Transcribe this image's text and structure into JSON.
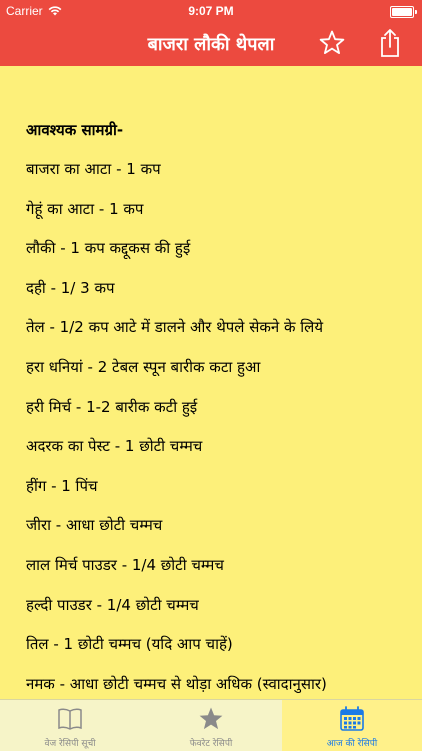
{
  "statusbar": {
    "carrier": "Carrier",
    "time": "9:07 PM"
  },
  "navbar": {
    "title": "बाजरा लौकी थेपला",
    "favorite_icon": "star-outline-icon",
    "share_icon": "share-icon"
  },
  "recipe": {
    "heading": "आवश्यक सामग्री-",
    "ingredients": [
      "बाजरा का आटा - 1 कप",
      "गेहूं का आटा - 1 कप",
      "लौकी - 1 कप कद्दूकस की हुई",
      "दही - 1/ 3 कप",
      "तेल - 1/2 कप आटे में डालने और थेपले सेकने के लिये",
      "हरा धनियां - 2 टेबल स्पून बारीक कटा हुआ",
      "हरी मिर्च - 1-2 बारीक कटी हुई",
      "अदरक का पेस्ट - 1 छोटी चम्मच",
      "हींग - 1 पिंच",
      "जीरा - आधा छोटी चम्मच",
      "लाल मिर्च पाउडर - 1/4 छोटी चम्मच",
      "हल्दी पाउडर - 1/4 छोटी चम्मच",
      "तिल - 1 छोटी चम्मच (यदि आप चाहें)",
      "नमक - आधा छोटी चम्मच से थोड़ा अधिक (स्वादानुसार)"
    ]
  },
  "tabbar": {
    "tabs": [
      {
        "label": "वेज रेसिपी सूची",
        "icon": "book-icon",
        "active": false
      },
      {
        "label": "फेवरेट रेसिपी",
        "icon": "star-icon",
        "active": false
      },
      {
        "label": "आज की रेसिपी",
        "icon": "calendar-icon",
        "active": true
      }
    ]
  },
  "colors": {
    "navbar": "#ec4a3f",
    "background": "#fdf07a",
    "tabbar": "#f6f4c8",
    "active_tab": "#1a7ae6"
  }
}
